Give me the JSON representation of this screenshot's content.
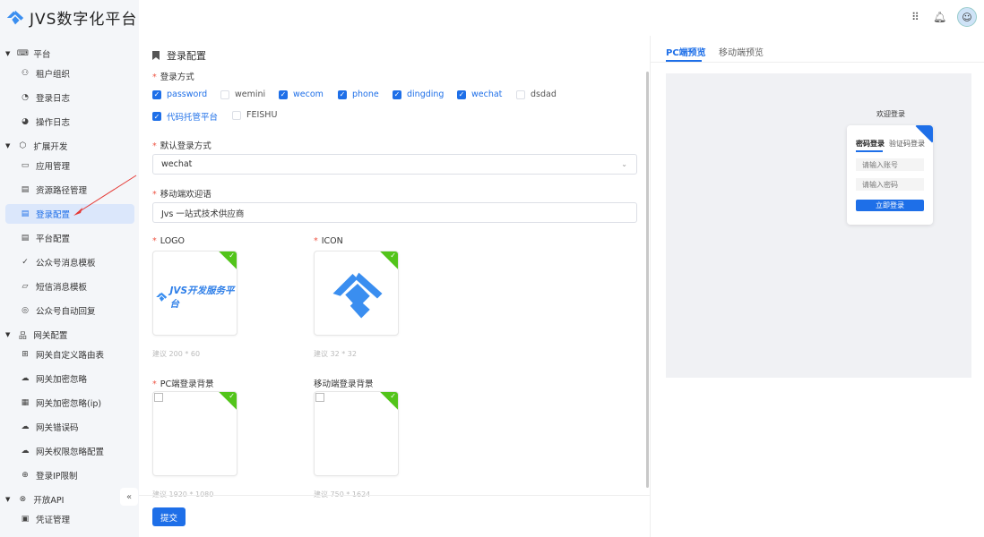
{
  "app": {
    "title": "JVS数字化平台"
  },
  "sidebar": {
    "items": [
      {
        "type": "group",
        "label": "平台",
        "icon": "keyboard-icon"
      },
      {
        "type": "item",
        "label": "租户组织",
        "icon": "users-icon"
      },
      {
        "type": "item",
        "label": "登录日志",
        "icon": "log-icon"
      },
      {
        "type": "item",
        "label": "操作日志",
        "icon": "operation-log-icon"
      },
      {
        "type": "group",
        "label": "扩展开发",
        "icon": "cube-icon"
      },
      {
        "type": "item",
        "label": "应用管理",
        "icon": "terminal-icon"
      },
      {
        "type": "item",
        "label": "资源路径管理",
        "icon": "list-icon"
      },
      {
        "type": "item",
        "label": "登录配置",
        "icon": "list-icon",
        "active": true
      },
      {
        "type": "item",
        "label": "平台配置",
        "icon": "list-icon"
      },
      {
        "type": "item",
        "label": "公众号消息模板",
        "icon": "check-circle-icon"
      },
      {
        "type": "item",
        "label": "短信消息模板",
        "icon": "message-icon"
      },
      {
        "type": "item",
        "label": "公众号自动回复",
        "icon": "reply-icon"
      },
      {
        "type": "group",
        "label": "网关配置",
        "icon": "network-icon"
      },
      {
        "type": "item",
        "label": "网关自定义路由表",
        "icon": "route-icon"
      },
      {
        "type": "item",
        "label": "网关加密忽略",
        "icon": "cloud-icon"
      },
      {
        "type": "item",
        "label": "网关加密忽略(ip)",
        "icon": "server-icon"
      },
      {
        "type": "item",
        "label": "网关错误码",
        "icon": "cloud-error-icon"
      },
      {
        "type": "item",
        "label": "网关权限忽略配置",
        "icon": "cloud-lock-icon"
      },
      {
        "type": "item",
        "label": "登录IP限制",
        "icon": "globe-icon"
      },
      {
        "type": "group",
        "label": "开放API",
        "icon": "api-icon"
      },
      {
        "type": "item",
        "label": "凭证管理",
        "icon": "credential-icon"
      }
    ],
    "collapse": "«"
  },
  "form": {
    "title": "登录配置",
    "login_methods_label": "登录方式",
    "login_methods": [
      {
        "label": "password",
        "checked": true
      },
      {
        "label": "wemini",
        "checked": false
      },
      {
        "label": "wecom",
        "checked": true
      },
      {
        "label": "phone",
        "checked": true
      },
      {
        "label": "dingding",
        "checked": true
      },
      {
        "label": "wechat",
        "checked": true
      },
      {
        "label": "dsdad",
        "checked": false
      },
      {
        "label": "代码托管平台",
        "checked": true
      },
      {
        "label": "FEISHU",
        "checked": false
      }
    ],
    "default_label": "默认登录方式",
    "default_value": "wechat",
    "welcome_label": "移动端欢迎语",
    "welcome_value": "Jvs 一站式技术供应商",
    "logo_label": "LOGO",
    "logo_text": "JVS开发服务平台",
    "logo_hint": "建议 200 * 60",
    "icon_label": "ICON",
    "icon_hint": "建议 32 * 32",
    "pc_bg_label": "PC端登录背景",
    "pc_bg_hint": "建议 1920 * 1080",
    "mobile_bg_label": "移动端登录背景",
    "mobile_bg_hint": "建议 750 * 1624",
    "submit": "提交"
  },
  "preview": {
    "tabs": [
      "PC端预览",
      "移动端预览"
    ],
    "welcome": "欢迎登录",
    "tab_password": "密码登录",
    "tab_code": "验证码登录",
    "account_ph": "请输入账号",
    "password_ph": "请输入密码",
    "login_btn": "立即登录"
  },
  "colors": {
    "accent": "#1e6fe8",
    "success": "#52c41a",
    "sidebar_bg": "#f4f6f9"
  }
}
